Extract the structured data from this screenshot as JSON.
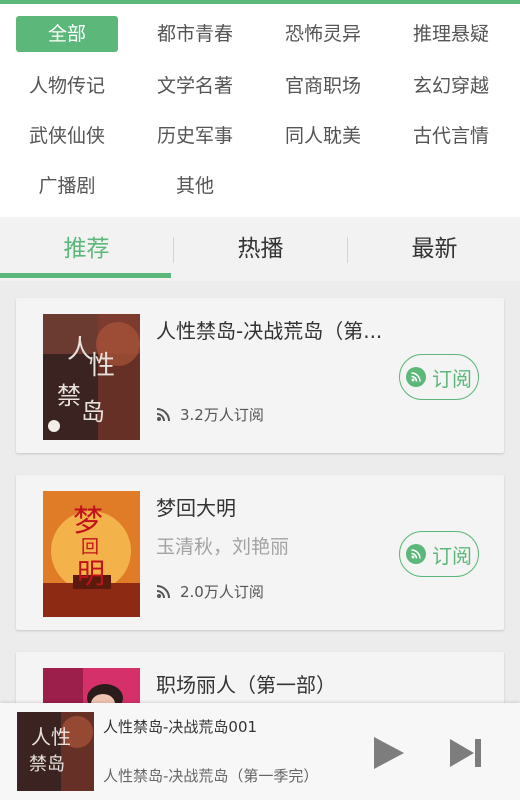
{
  "colors": {
    "accent": "#5cb87a",
    "card_bg": "#f4f4f4",
    "page_bg": "#ececec"
  },
  "categories": [
    {
      "label": "全部",
      "active": true
    },
    {
      "label": "都市青春"
    },
    {
      "label": "恐怖灵异"
    },
    {
      "label": "推理悬疑"
    },
    {
      "label": "人物传记"
    },
    {
      "label": "文学名著"
    },
    {
      "label": "官商职场"
    },
    {
      "label": "玄幻穿越"
    },
    {
      "label": "武侠仙侠"
    },
    {
      "label": "历史军事"
    },
    {
      "label": "同人耽美"
    },
    {
      "label": "古代言情"
    },
    {
      "label": "广播剧"
    },
    {
      "label": "其他"
    }
  ],
  "tabs": [
    {
      "label": "推荐",
      "active": true
    },
    {
      "label": "热播"
    },
    {
      "label": "最新"
    }
  ],
  "books": [
    {
      "title": "人性禁岛-决战荒岛（第...",
      "author": "",
      "subscribers": "3.2万人订阅",
      "subscribe_label": "订阅",
      "cover_icon": "book-cover-dark-red"
    },
    {
      "title": "梦回大明",
      "author": "玉清秋，刘艳丽",
      "subscribers": "2.0万人订阅",
      "subscribe_label": "订阅",
      "cover_icon": "book-cover-orange-moon"
    },
    {
      "title": "职场丽人（第一部）",
      "author": "",
      "subscribers": "",
      "subscribe_label": "",
      "cover_icon": "book-cover-pink"
    }
  ],
  "player": {
    "episode": "人性禁岛-决战荒岛001",
    "series": "人性禁岛-决战荒岛（第一季完）",
    "play_icon": "play-icon",
    "next_icon": "skip-next-icon"
  }
}
